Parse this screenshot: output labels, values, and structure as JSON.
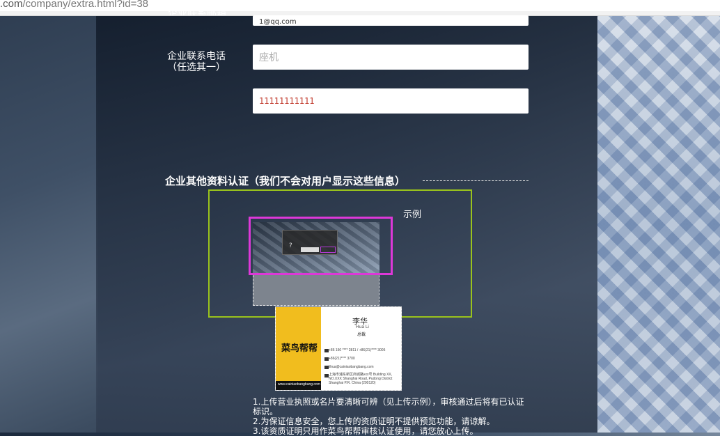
{
  "browser": {
    "url_domain": ".com",
    "url_path": "/company/extra.html?id=38"
  },
  "form": {
    "email_label_partial": "企业联系邮箱",
    "email_value_partial": "1@qq.com",
    "phone_label_line1": "企业联系电话",
    "phone_label_line2": "（任选其一）",
    "landline_placeholder": "座机",
    "mobile_value": "11111111111"
  },
  "section": {
    "title": "企业其他资料认证（我们不会对用户显示这些信息）",
    "example_label": "示例"
  },
  "sample_card": {
    "brand": "菜鸟帮帮",
    "name": "李华",
    "name_en": "Hua Li",
    "position": "总裁",
    "phone": "+86 150 **** 2811 / +86(21)**** 3005",
    "fax": "+86(21)**** 3700",
    "email": "lihua@cainiaobangbang.com",
    "address": "上海市浦东新区商城路xxx号 Building XX, NO.XXX Shanghai Road, Pudong District Shanghai P.R. China (200120)",
    "website": "www.cainiaobangbang.com"
  },
  "notes": [
    "1.上传营业执照或名片要清晰可辨（见上传示例），审核通过后将有已认证标识。",
    "2.为保证信息安全，您上传的资质证明不提供预览功能，请谅解。",
    "3.该资质证明只用作菜鸟帮帮审核认证使用，请您放心上传。"
  ],
  "colors": {
    "highlight_green": "#9ac31c",
    "highlight_magenta": "#dd38d8",
    "card_yellow": "#f1bd1e",
    "error_text": "#c0392b"
  }
}
